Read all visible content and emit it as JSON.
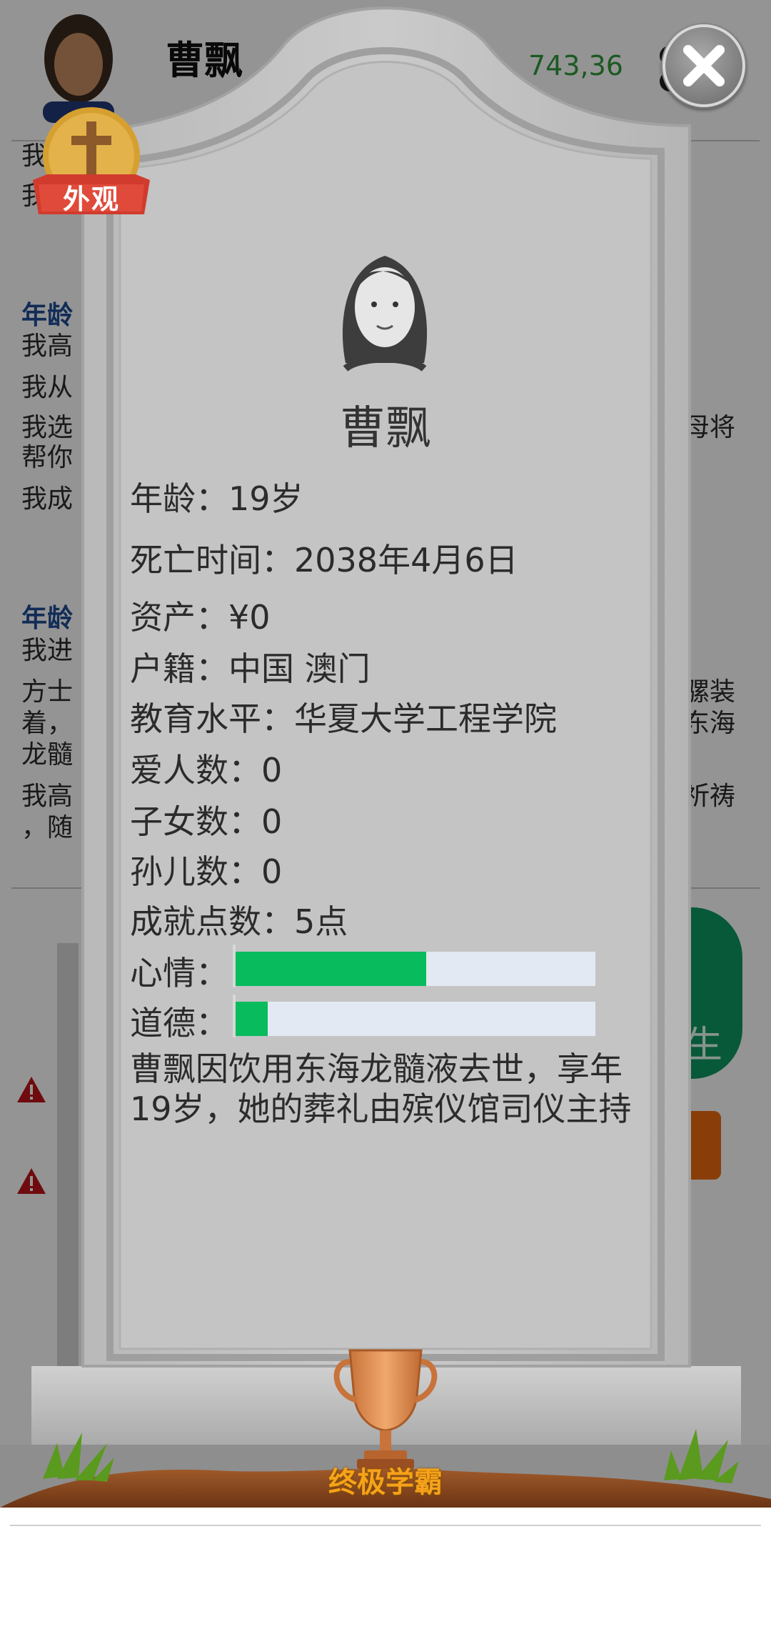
{
  "background": {
    "player_name": "曹飘",
    "money": "743,36",
    "life_log_lines": [
      "我",
      "我"
    ],
    "age_header_1": "年龄",
    "section1": [
      "我高",
      "我从",
      "我选",
      "帮你",
      "我成"
    ],
    "section1_right": "母将",
    "age_header_2": "年龄",
    "section2": [
      "我进",
      "方士",
      "着，",
      "龙髓",
      "我高",
      "，随"
    ],
    "section2_right": [
      "骡装",
      "东海",
      "祈祷"
    ],
    "green_button_label": "生"
  },
  "outfit": {
    "label": "外观"
  },
  "tombstone": {
    "name": "曹飘",
    "age": "年龄：19岁",
    "death_time": "死亡时间：2038年4月6日",
    "assets": "资产：¥0",
    "hometown": "户籍：中国 澳门",
    "education": "教育水平：华夏大学工程学院",
    "lovers": "爱人数：0",
    "children": "子女数：0",
    "grandchildren": "孙儿数：0",
    "achievement_points": "成就点数：5点",
    "mood_label": "心情：",
    "mood_value": 0.53,
    "morality_label": "道德：",
    "morality_value": 0.09,
    "epitaph": "曹飘因饮用东海龙髓液去世，享年19岁，她的葬礼由殡仪馆司仪主持",
    "trophy_title": "终极学霸"
  },
  "colors": {
    "bar_fill": "#08bb5d",
    "bar_track": "#e2e9f2",
    "stone": "#c6c6c6",
    "trophy_label": "#f6a21a"
  },
  "icons": [
    "close-icon",
    "cross-icon",
    "avatar-icon",
    "trophy-icon",
    "warning-icon",
    "grass-icon"
  ]
}
